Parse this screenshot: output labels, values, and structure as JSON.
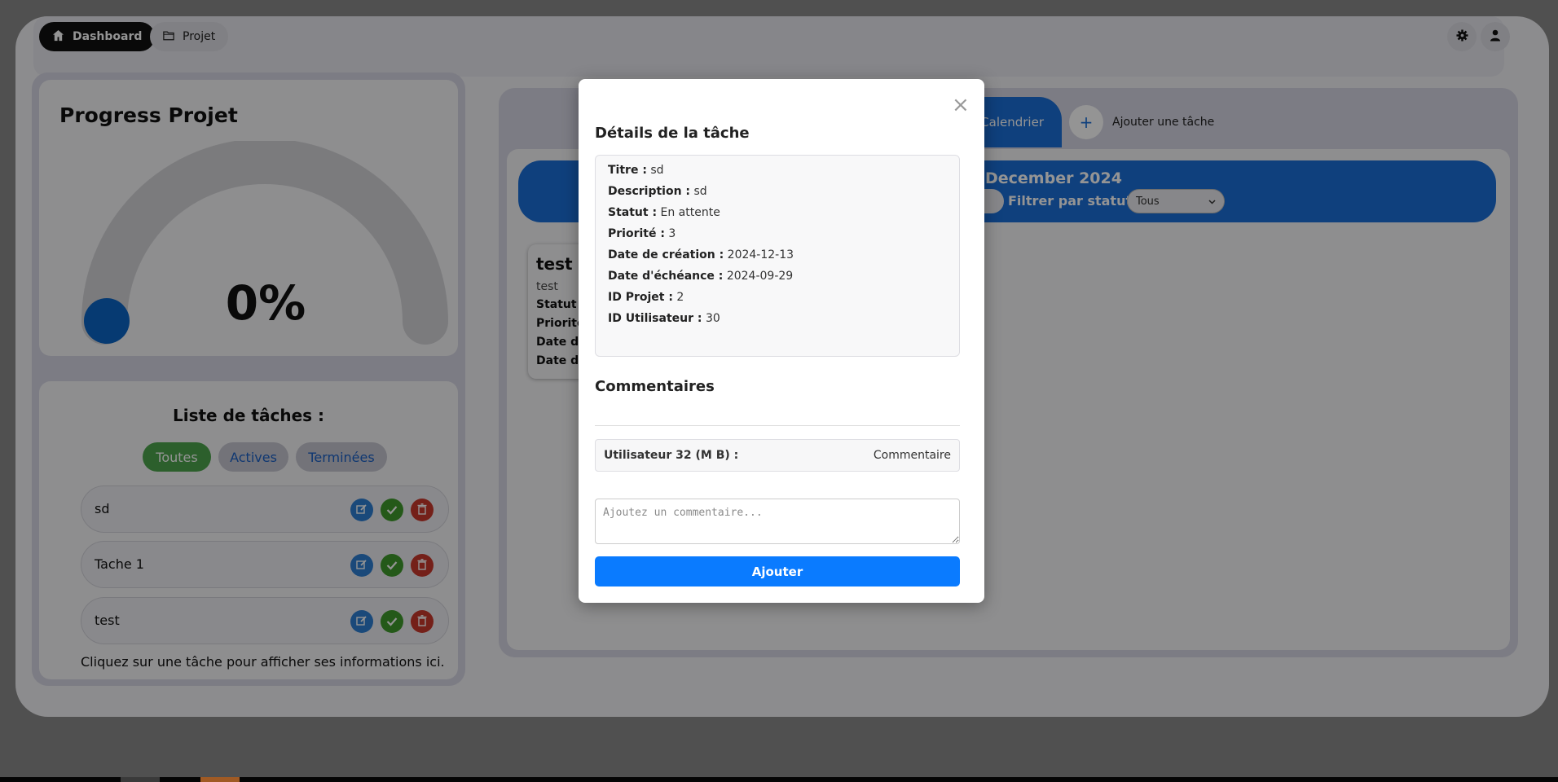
{
  "topbar": {
    "dashboard_label": "Dashboard",
    "project_label": "Projet",
    "icons": [
      "home-icon",
      "folder-icon",
      "gear-icon",
      "user-icon"
    ]
  },
  "progress": {
    "title": "Progress Projet",
    "percent_label": "0%",
    "value": 0,
    "fill_color": "#0b64c4",
    "track_color": "#d4d4d8"
  },
  "tasks": {
    "title": "Liste de tâches :",
    "filters": [
      "Toutes",
      "Actives",
      "Terminées"
    ],
    "items": [
      {
        "name": "sd"
      },
      {
        "name": "Tache 1"
      },
      {
        "name": "test"
      }
    ],
    "hint": "Cliquez sur une tâche pour afficher ses informations ici."
  },
  "calendar": {
    "tab_label": "Calendrier",
    "add_label": "Ajouter une tâche",
    "month": "December 2024",
    "filter_label": "Filtrer par statut :",
    "filter_value": "Tous",
    "card": {
      "title": "test",
      "desc": "test",
      "lines": [
        "Statut :",
        "Priorité",
        "Date de",
        "Date d'é"
      ]
    }
  },
  "modal": {
    "close": "×",
    "title": "Détails de la tâche",
    "details": [
      {
        "label": "Titre :",
        "value": "sd"
      },
      {
        "label": "Description :",
        "value": "sd"
      },
      {
        "label": "Statut :",
        "value": "En attente"
      },
      {
        "label": "Priorité :",
        "value": "3"
      },
      {
        "label": "Date de création :",
        "value": "2024-12-13"
      },
      {
        "label": "Date d'échéance :",
        "value": "2024-09-29"
      },
      {
        "label": "ID Projet :",
        "value": "2"
      },
      {
        "label": "ID Utilisateur :",
        "value": "30"
      }
    ],
    "comments_title": "Commentaires",
    "comments": [
      {
        "user": "Utilisateur 32 (M B) :",
        "text": "Commentaire"
      }
    ],
    "comment_placeholder": "Ajoutez un commentaire...",
    "submit_label": "Ajouter"
  }
}
